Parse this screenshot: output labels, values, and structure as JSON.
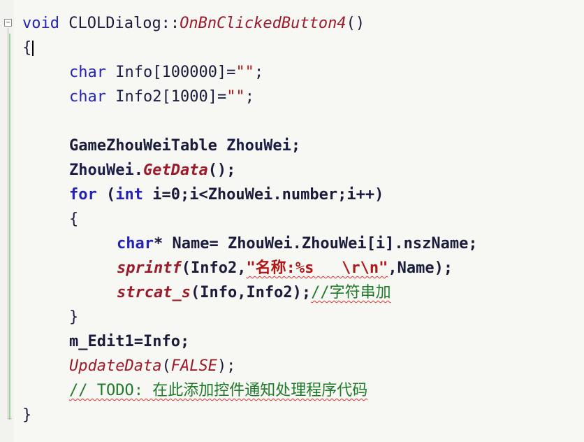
{
  "editor": {
    "lines": [
      {
        "tokens": [
          {
            "t": "void ",
            "c": "kw"
          },
          {
            "t": "CLOLDialog::",
            "c": "type"
          },
          {
            "t": "OnBnClickedButton4",
            "c": "fn"
          },
          {
            "t": "()",
            "c": "type"
          }
        ]
      },
      {
        "tokens": [
          {
            "t": "{",
            "c": "type"
          }
        ]
      },
      {
        "tokens": [
          {
            "t": "char ",
            "c": "kw"
          },
          {
            "t": "Info",
            "c": "name"
          },
          {
            "t": "[100000]=",
            "c": "type"
          },
          {
            "t": "\"\"",
            "c": "str"
          },
          {
            "t": ";",
            "c": "type"
          }
        ]
      },
      {
        "tokens": [
          {
            "t": "char ",
            "c": "kw"
          },
          {
            "t": "Info2",
            "c": "name"
          },
          {
            "t": "[1000]=",
            "c": "type"
          },
          {
            "t": "\"\"",
            "c": "str"
          },
          {
            "t": ";",
            "c": "type"
          }
        ]
      },
      {
        "tokens": []
      },
      {
        "tokens": [
          {
            "t": "GameZhouWeiTable ",
            "c": "type"
          },
          {
            "t": "ZhouWei",
            "c": "name"
          },
          {
            "t": ";",
            "c": "type"
          }
        ]
      },
      {
        "tokens": [
          {
            "t": "ZhouWei.",
            "c": "name"
          },
          {
            "t": "GetData",
            "c": "fn"
          },
          {
            "t": "();",
            "c": "type"
          }
        ]
      },
      {
        "tokens": [
          {
            "t": "for ",
            "c": "kw"
          },
          {
            "t": "(",
            "c": "type"
          },
          {
            "t": "int ",
            "c": "kw"
          },
          {
            "t": "i=0;i<ZhouWei.number;i++)",
            "c": "type"
          }
        ]
      },
      {
        "tokens": [
          {
            "t": "{",
            "c": "type"
          }
        ]
      },
      {
        "tokens": [
          {
            "t": "char",
            "c": "kw"
          },
          {
            "t": "* Name= ZhouWei.ZhouWei[i].nszName;",
            "c": "type"
          }
        ]
      },
      {
        "tokens": [
          {
            "t": "sprintf",
            "c": "fn"
          },
          {
            "t": "(Info2,",
            "c": "type"
          },
          {
            "t": "\"名称:%s   \\r\\n\"",
            "c": "str"
          },
          {
            "t": ",Name);",
            "c": "type"
          }
        ]
      },
      {
        "tokens": [
          {
            "t": "strcat_s",
            "c": "fn"
          },
          {
            "t": "(Info,Info2);",
            "c": "type"
          },
          {
            "t": "//字符串加",
            "c": "cmt"
          }
        ]
      },
      {
        "tokens": [
          {
            "t": "}",
            "c": "type"
          }
        ]
      },
      {
        "tokens": [
          {
            "t": "m_Edit1=Info;",
            "c": "type"
          }
        ]
      },
      {
        "tokens": [
          {
            "t": "UpdateData",
            "c": "fn"
          },
          {
            "t": "(",
            "c": "type"
          },
          {
            "t": "FALSE",
            "c": "fn"
          },
          {
            "t": ");",
            "c": "type"
          }
        ]
      },
      {
        "tokens": [
          {
            "t": "// TODO: 在此添加控件通知处理程序代码",
            "c": "cmt"
          }
        ]
      },
      {
        "tokens": [
          {
            "t": "}",
            "c": "type"
          }
        ]
      }
    ]
  },
  "gutter": {
    "fold_glyph": "−"
  }
}
